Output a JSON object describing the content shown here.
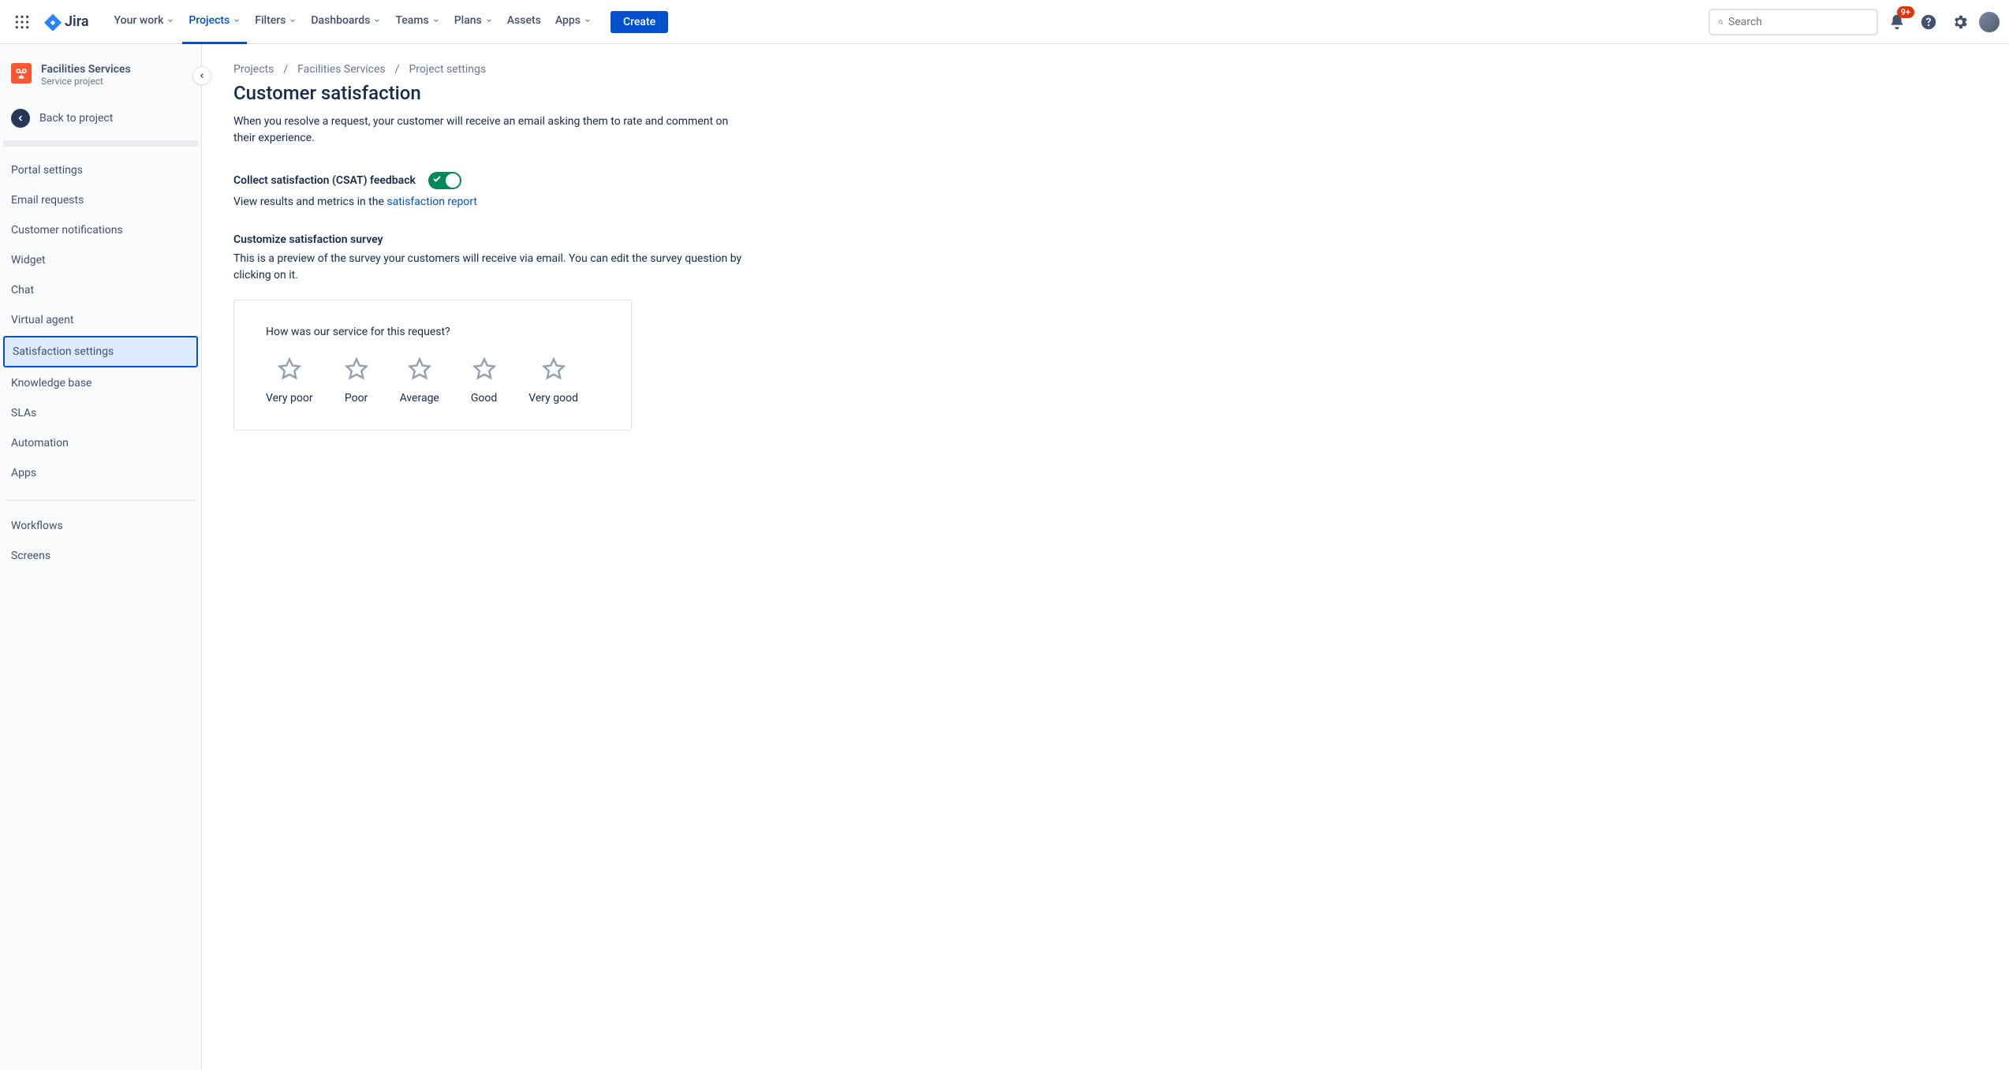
{
  "topnav": {
    "logo_text": "Jira",
    "items": [
      "Your work",
      "Projects",
      "Filters",
      "Dashboards",
      "Teams",
      "Plans",
      "Assets",
      "Apps"
    ],
    "active_index": 1,
    "no_chevron": [
      6
    ],
    "create_label": "Create",
    "search_placeholder": "Search",
    "notification_badge": "9+"
  },
  "sidebar": {
    "project_name": "Facilities Services",
    "project_type": "Service project",
    "back_label": "Back to project",
    "group1": [
      "Portal settings",
      "Email requests",
      "Customer notifications",
      "Widget",
      "Chat",
      "Virtual agent",
      "Satisfaction settings",
      "Knowledge base",
      "SLAs",
      "Automation",
      "Apps"
    ],
    "selected_index": 6,
    "group2": [
      "Workflows",
      "Screens"
    ]
  },
  "breadcrumb": [
    "Projects",
    "Facilities Services",
    "Project settings"
  ],
  "page": {
    "title": "Customer satisfaction",
    "description": "When you resolve a request, your customer will receive an email asking them to rate and comment on their experience.",
    "csat_label": "Collect satisfaction (CSAT) feedback",
    "results_prefix": "View results and metrics in the ",
    "results_link": "satisfaction report",
    "customize_heading": "Customize satisfaction survey",
    "customize_desc": "This is a preview of the survey your customers will receive via email. You can edit the survey question by clicking on it.",
    "survey_question": "How was our service for this request?",
    "ratings": [
      "Very poor",
      "Poor",
      "Average",
      "Good",
      "Very good"
    ]
  }
}
